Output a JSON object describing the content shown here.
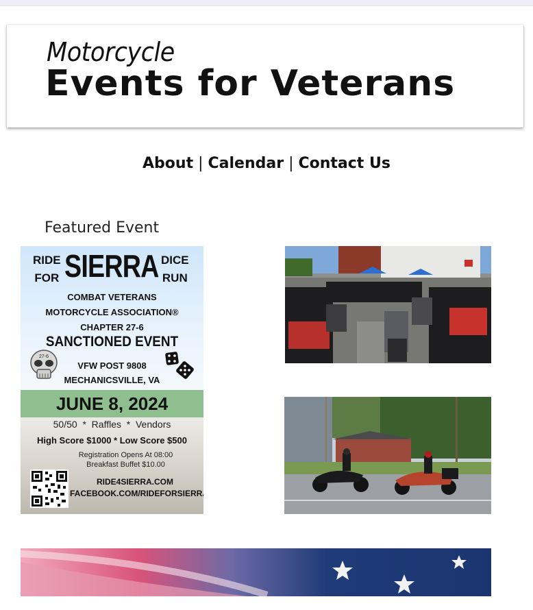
{
  "header": {
    "title_small": "Motorcycle",
    "title_big": "Events for Veterans"
  },
  "nav": {
    "about": "About",
    "sep1": " | ",
    "calendar": "Calendar",
    "sep2": " | ",
    "contact": "Contact Us"
  },
  "featured_heading": "Featured Event",
  "poster": {
    "ride_for": [
      "RIDE",
      "FOR"
    ],
    "name": "SIERRA",
    "dice_run": [
      "DICE",
      "RUN"
    ],
    "org_lines": [
      "COMBAT VETERANS",
      "MOTORCYCLE ASSOCIATION®",
      "CHAPTER 27-6"
    ],
    "sanctioned": "SANCTIONED EVENT",
    "venue_lines": [
      "VFW POST 9808",
      "MECHANICSVILLE, VA"
    ],
    "skull_text": "27-6",
    "date": "JUNE 8, 2024",
    "extras": "50/50  *  Raffles  *  Vendors",
    "scores": "High Score $1000  *  Low Score $500",
    "registration": "Registration Opens At 08:00",
    "breakfast": "Breakfast Buffet $10.00",
    "website": "RIDE4SIERRA.COM",
    "facebook": "FACEBOOK.COM/RIDEFORSIERRA"
  },
  "colors": {
    "date_band": "#8fbf8f",
    "sky": "#cfe6fb",
    "flag_blue": "#1f3c78",
    "flag_red": "#d9537a"
  }
}
